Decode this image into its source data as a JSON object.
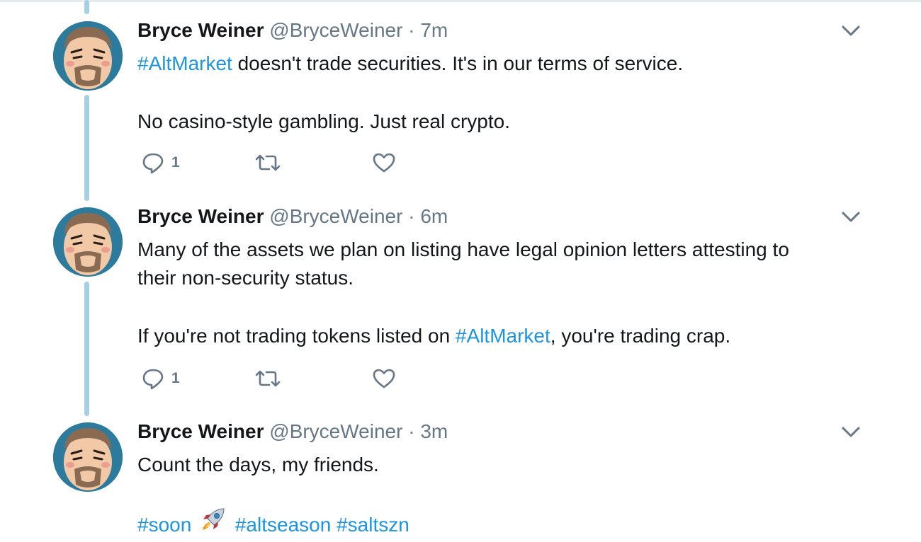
{
  "author": {
    "name": "Bryce Weiner",
    "handle": "@BryceWeiner"
  },
  "separator": "·",
  "tweets": [
    {
      "time": "7m",
      "body": {
        "line1_tag": "#AltMarket",
        "line1_rest": " doesn't trade securities.  It's in our terms of service.",
        "line2": "No casino-style gambling.  Just real crypto."
      },
      "reply_count": "1"
    },
    {
      "time": "6m",
      "body": {
        "line1": "Many of the assets we plan on listing have legal opinion letters attesting to",
        "line2": "their non-security status.",
        "line3_pre": "If you're not trading tokens listed on ",
        "line3_tag": "#AltMarket",
        "line3_post": ", you're trading crap."
      },
      "reply_count": "1"
    },
    {
      "time": "3m",
      "body": {
        "line1": "Count the days, my friends.",
        "tag1": "#soon",
        "tag2": "#altseason",
        "tag3": "#saltszn"
      }
    }
  ],
  "icons": {
    "reply": "reply-icon",
    "retweet": "retweet-icon",
    "like": "heart-icon",
    "more": "chevron-down-icon",
    "emoji": "rocket-emoji"
  },
  "colors": {
    "link": "#1b95e0",
    "secondary_text": "#657786",
    "thread_line": "#a5cfe3",
    "avatar_bg": "#2d7b9c"
  }
}
